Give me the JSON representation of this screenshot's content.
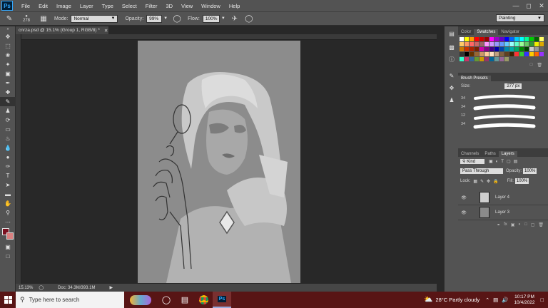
{
  "menubar": {
    "logo": "Ps",
    "items": [
      "File",
      "Edit",
      "Image",
      "Layer",
      "Type",
      "Select",
      "Filter",
      "3D",
      "View",
      "Window",
      "Help"
    ]
  },
  "options": {
    "brush_size": "278",
    "mode_label": "Mode:",
    "mode_value": "Normal",
    "opacity_label": "Opacity:",
    "opacity_value": "99%",
    "flow_label": "Flow:",
    "flow_value": "100%",
    "workspace": "Painting"
  },
  "document": {
    "tab_title": "cnrza.psd @ 15.1% (Group 1, RGB/8) *",
    "zoom": "15.13%",
    "doc_size": "Doc: 34.3M/393.1M"
  },
  "color_panel": {
    "tabs": [
      "Color",
      "Swatches",
      "Navigator"
    ],
    "swatches": [
      "#ffffff",
      "#ffff00",
      "#ff9900",
      "#ff0000",
      "#cc0000",
      "#990000",
      "#ff00ff",
      "#9900cc",
      "#6600cc",
      "#0000ff",
      "#0066ff",
      "#00ccff",
      "#00ffff",
      "#00ff99",
      "#00cc00",
      "#006600",
      "#ffff66",
      "#ffcc66",
      "#ff9966",
      "#ff6666",
      "#cc6666",
      "#996666",
      "#ff99ff",
      "#cc99ff",
      "#9999ff",
      "#6699ff",
      "#66ccff",
      "#99ffff",
      "#66ffcc",
      "#99ff99",
      "#66cc66",
      "#339933",
      "#eeee00",
      "#ddaa00",
      "#cc7700",
      "#cc3300",
      "#aa2200",
      "#772200",
      "#cc00aa",
      "#880088",
      "#440088",
      "#0000aa",
      "#0044aa",
      "#0088aa",
      "#00aaaa",
      "#00aa66",
      "#008800",
      "#004400",
      "#cccccc",
      "#999999",
      "#666666",
      "#333333",
      "#000000",
      "#663300",
      "#996633",
      "#cc9966",
      "#ffcc99",
      "#ffe0c0",
      "#c0a080",
      "#806040",
      "#604020",
      "#402000",
      "#ff3333",
      "#33cc33",
      "#3333ff",
      "#ffcc00",
      "#ff6600",
      "#9933ff",
      "#33ffcc",
      "#cc3366",
      "#336699",
      "#669933",
      "#cc9900",
      "#993366",
      "#006699",
      "#669999",
      "#996699",
      "#999966"
    ]
  },
  "brush_presets": {
    "title": "Brush Presets",
    "size_label": "Size:",
    "size_value": "277 px",
    "sizes": [
      "34",
      "34",
      "12",
      "34"
    ]
  },
  "layers_panel": {
    "tabs": [
      "Channels",
      "Paths",
      "Layers"
    ],
    "kind_label": "Kind",
    "blend_mode": "Pass Through",
    "opacity_label": "Opacity:",
    "opacity_value": "100%",
    "lock_label": "Lock:",
    "fill_label": "Fill:",
    "fill_value": "100%",
    "layers": [
      {
        "name": "Layer 4"
      },
      {
        "name": "Layer 3"
      }
    ]
  },
  "taskbar": {
    "search_placeholder": "Type here to search",
    "weather": "28°C  Partly cloudy",
    "time": "10:17 PM",
    "date": "10/4/2022"
  },
  "colors": {
    "foreground": "#7a1020",
    "background": "#d98080",
    "taskbar": "#581515"
  }
}
